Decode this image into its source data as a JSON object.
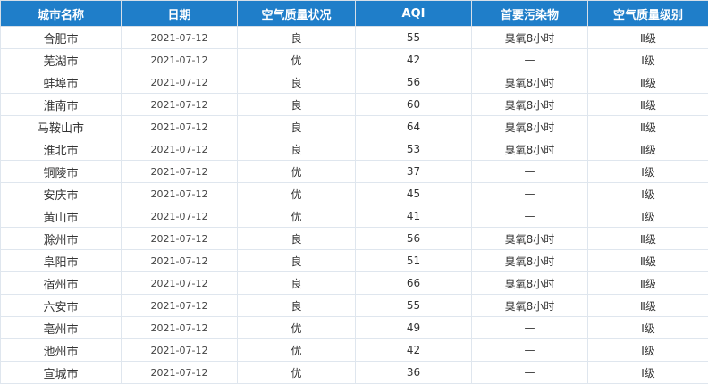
{
  "table": {
    "headers": [
      "城市名称",
      "日期",
      "空气质量状况",
      "AQI",
      "首要污染物",
      "空气质量级别"
    ],
    "rows": [
      [
        "合肥市",
        "2021-07-12",
        "良",
        "55",
        "臭氧8小时",
        "Ⅱ级"
      ],
      [
        "芜湖市",
        "2021-07-12",
        "优",
        "42",
        "—",
        "Ⅰ级"
      ],
      [
        "蚌埠市",
        "2021-07-12",
        "良",
        "56",
        "臭氧8小时",
        "Ⅱ级"
      ],
      [
        "淮南市",
        "2021-07-12",
        "良",
        "60",
        "臭氧8小时",
        "Ⅱ级"
      ],
      [
        "马鞍山市",
        "2021-07-12",
        "良",
        "64",
        "臭氧8小时",
        "Ⅱ级"
      ],
      [
        "淮北市",
        "2021-07-12",
        "良",
        "53",
        "臭氧8小时",
        "Ⅱ级"
      ],
      [
        "铜陵市",
        "2021-07-12",
        "优",
        "37",
        "—",
        "Ⅰ级"
      ],
      [
        "安庆市",
        "2021-07-12",
        "优",
        "45",
        "—",
        "Ⅰ级"
      ],
      [
        "黄山市",
        "2021-07-12",
        "优",
        "41",
        "—",
        "Ⅰ级"
      ],
      [
        "滁州市",
        "2021-07-12",
        "良",
        "56",
        "臭氧8小时",
        "Ⅱ级"
      ],
      [
        "阜阳市",
        "2021-07-12",
        "良",
        "51",
        "臭氧8小时",
        "Ⅱ级"
      ],
      [
        "宿州市",
        "2021-07-12",
        "良",
        "66",
        "臭氧8小时",
        "Ⅱ级"
      ],
      [
        "六安市",
        "2021-07-12",
        "良",
        "55",
        "臭氧8小时",
        "Ⅱ级"
      ],
      [
        "亳州市",
        "2021-07-12",
        "优",
        "49",
        "—",
        "Ⅰ级"
      ],
      [
        "池州市",
        "2021-07-12",
        "优",
        "42",
        "—",
        "Ⅰ级"
      ],
      [
        "宣城市",
        "2021-07-12",
        "优",
        "36",
        "—",
        "Ⅰ级"
      ]
    ]
  },
  "colors": {
    "header_bg": "#1f7ec9",
    "header_text": "#ffffff",
    "border": "#dfe6ee",
    "cell_text": "#333333"
  }
}
